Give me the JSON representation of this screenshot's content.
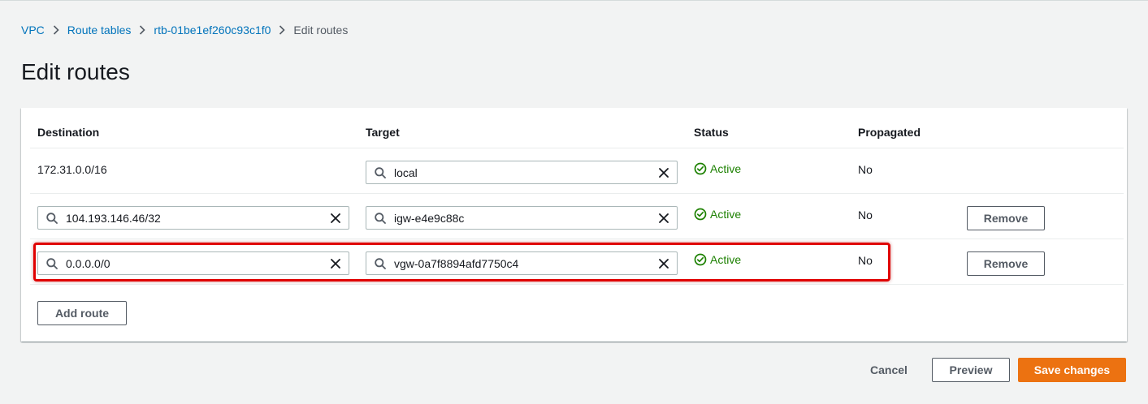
{
  "breadcrumb": {
    "items": [
      "VPC",
      "Route tables",
      "rtb-01be1ef260c93c1f0"
    ],
    "current": "Edit routes"
  },
  "page": {
    "title": "Edit routes"
  },
  "table": {
    "headers": {
      "destination": "Destination",
      "target": "Target",
      "status": "Status",
      "propagated": "Propagated"
    },
    "rows": [
      {
        "destination": "172.31.0.0/16",
        "target": "local",
        "status": "Active",
        "propagated": "No",
        "removable": false
      },
      {
        "destination": "104.193.146.46/32",
        "target": "igw-e4e9c88c",
        "status": "Active",
        "propagated": "No",
        "remove_label": "Remove"
      },
      {
        "destination": "0.0.0.0/0",
        "target": "vgw-0a7f8894afd7750c4",
        "status": "Active",
        "propagated": "No",
        "remove_label": "Remove"
      }
    ],
    "add_route_label": "Add route"
  },
  "footer": {
    "cancel_label": "Cancel",
    "preview_label": "Preview",
    "save_label": "Save changes"
  },
  "colors": {
    "link": "#0073bb",
    "active": "#1d8102",
    "primary": "#ec7211",
    "highlight": "#e00000"
  },
  "icons": {
    "search": "search-icon",
    "clear": "close-icon",
    "status": "check-circle-icon",
    "separator": "chevron-right-icon"
  }
}
